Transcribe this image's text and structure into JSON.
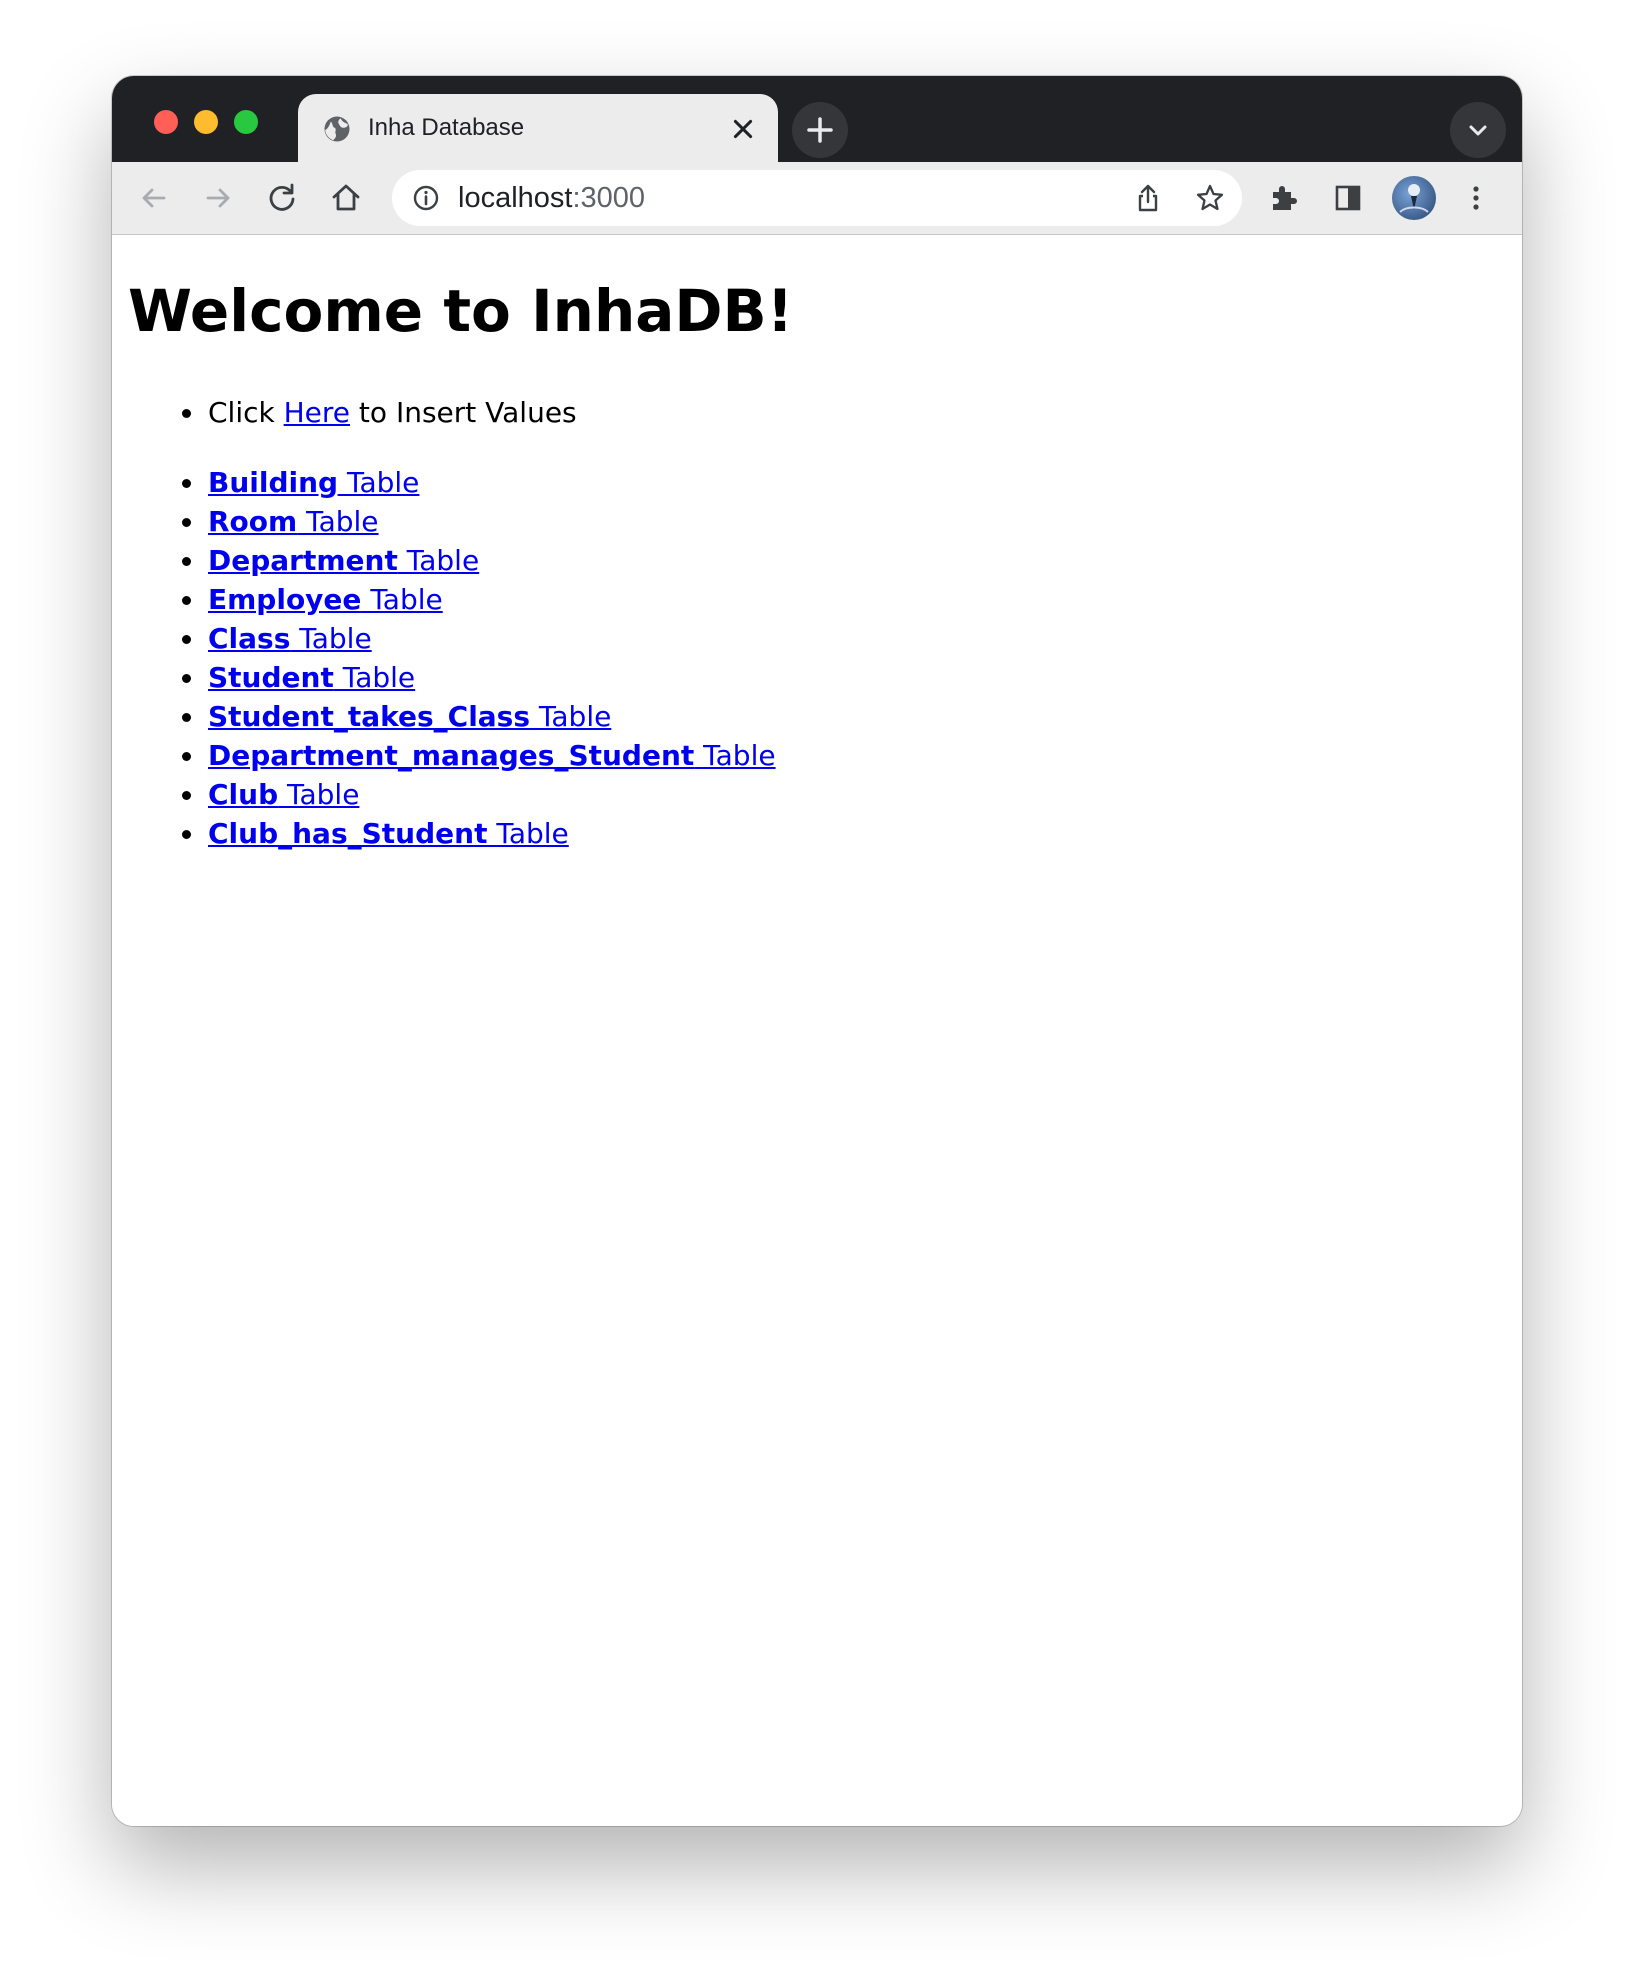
{
  "browser": {
    "tab_title": "Inha Database",
    "url_host": "localhost",
    "url_port": ":3000"
  },
  "page": {
    "heading": "Welcome to InhaDB!",
    "insert": {
      "prefix": "Click ",
      "link_text": "Here",
      "suffix": " to Insert Values"
    },
    "table_suffix": " Table",
    "tables": [
      {
        "name": "Building"
      },
      {
        "name": "Room"
      },
      {
        "name": "Department"
      },
      {
        "name": "Employee"
      },
      {
        "name": "Class"
      },
      {
        "name": "Student"
      },
      {
        "name": "Student_takes_Class"
      },
      {
        "name": "Department_manages_Student"
      },
      {
        "name": "Club"
      },
      {
        "name": "Club_has_Student"
      }
    ]
  },
  "icons": {
    "tab": "globe-icon",
    "close": "close-icon",
    "new_tab": "plus-icon",
    "tab_search": "chevron-down-icon",
    "back": "back-arrow-icon",
    "forward": "forward-arrow-icon",
    "reload": "reload-icon",
    "home": "home-icon",
    "site_info": "info-icon",
    "share": "share-icon",
    "bookmark": "star-icon",
    "extensions": "puzzle-icon",
    "side_panel": "side-panel-icon",
    "menu": "kebab-menu-icon"
  },
  "colors": {
    "titlebar": "#202124",
    "toolbar": "#ececec",
    "link": "#0000ee"
  }
}
